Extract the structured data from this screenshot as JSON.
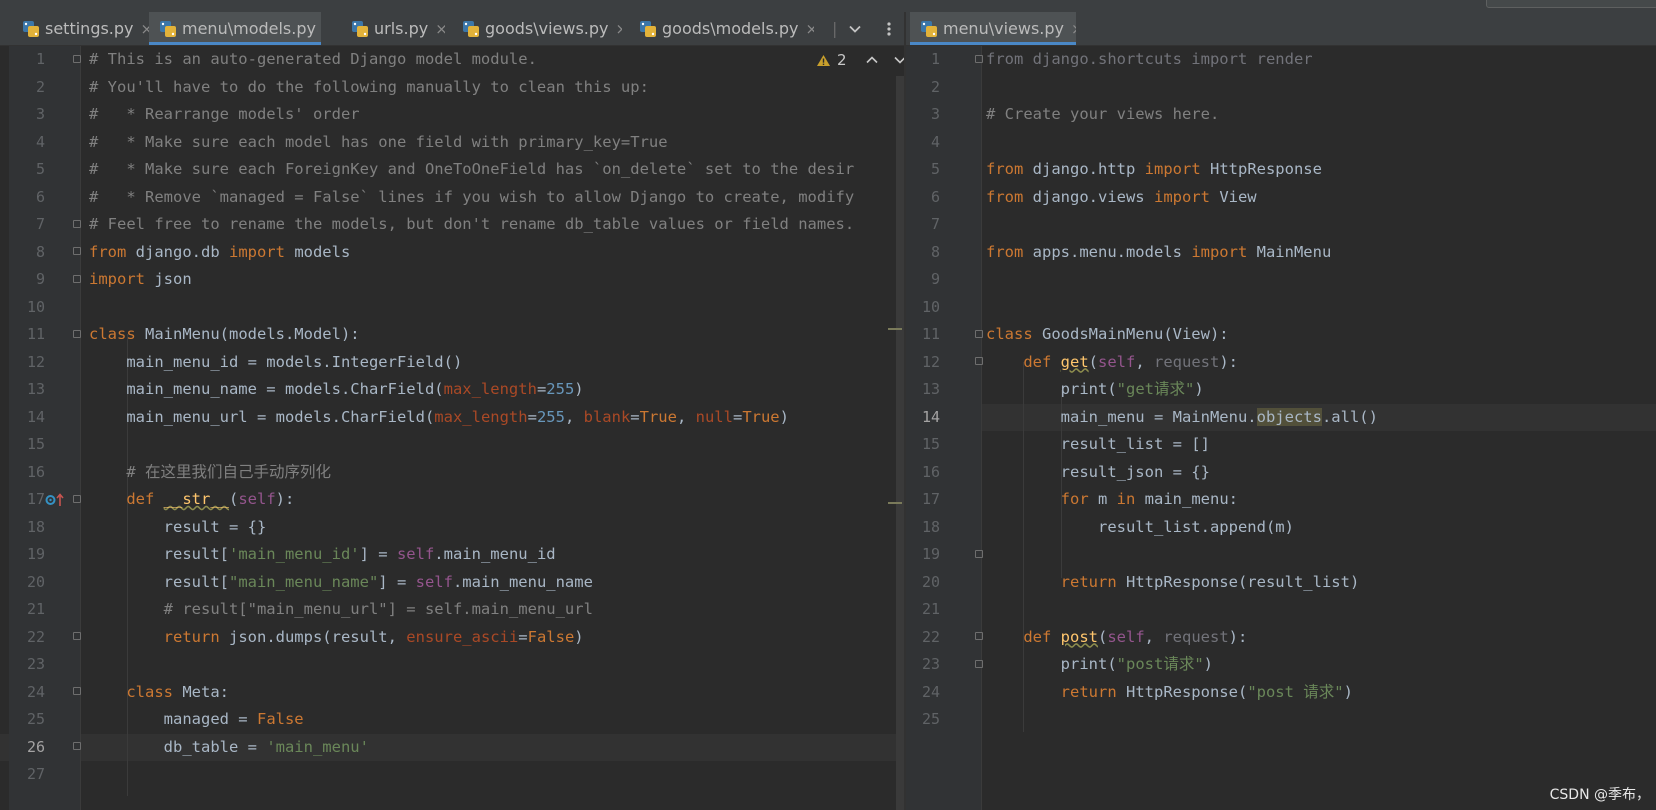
{
  "tabs_left": [
    {
      "label": "settings.py",
      "active": false
    },
    {
      "label": "menu\\models.py",
      "active": true
    },
    {
      "label": "urls.py",
      "active": false
    },
    {
      "label": "goods\\views.py",
      "active": false
    },
    {
      "label": "goods\\models.py",
      "active": false
    }
  ],
  "tabs_right": [
    {
      "label": "menu\\views.py",
      "active": true
    }
  ],
  "tab_close_glyph": "×",
  "tab_overflow_glyph": "|",
  "warnings": {
    "count": "2"
  },
  "left_editor": {
    "caret_line": 26,
    "lines": [
      "# This is an auto-generated Django model module.",
      "# You'll have to do the following manually to clean this up:",
      "#   * Rearrange models' order",
      "#   * Make sure each model has one field with primary_key=True",
      "#   * Make sure each ForeignKey and OneToOneField has `on_delete` set to the desir",
      "#   * Remove `managed = False` lines if you wish to allow Django to create, modify",
      "# Feel free to rename the models, but don't rename db_table values or field names.",
      "from django.db import models",
      "import json",
      "",
      "class MainMenu(models.Model):",
      "    main_menu_id = models.IntegerField()",
      "    main_menu_name = models.CharField(max_length=255)",
      "    main_menu_url = models.CharField(max_length=255, blank=True, null=True)",
      "",
      "    # 在这里我们自己手动序列化",
      "    def __str__(self):",
      "        result = {}",
      "        result['main_menu_id'] = self.main_menu_id",
      "        result[\"main_menu_name\"] = self.main_menu_name",
      "        # result[\"main_menu_url\"] = self.main_menu_url",
      "        return json.dumps(result, ensure_ascii=False)",
      "",
      "    class Meta:",
      "        managed = False",
      "        db_table = 'main_menu'",
      ""
    ]
  },
  "right_editor": {
    "caret_line": 14,
    "lines": [
      "from django.shortcuts import render",
      "",
      "# Create your views here.",
      "",
      "from django.http import HttpResponse",
      "from django.views import View",
      "",
      "from apps.menu.models import MainMenu",
      "",
      "",
      "class GoodsMainMenu(View):",
      "    def get(self, request):",
      "        print(\"get请求\")",
      "        main_menu = MainMenu.objects.all()",
      "        result_list = []",
      "        result_json = {}",
      "        for m in main_menu:",
      "            result_list.append(m)",
      "",
      "        return HttpResponse(result_list)",
      "",
      "    def post(self, request):",
      "        print(\"post请求\")",
      "        return HttpResponse(\"post 请求\")",
      ""
    ]
  },
  "watermark": "CSDN @季布，",
  "colors": {
    "background": "#2b2b2b",
    "gutter": "#313335",
    "keyword": "#cc7832",
    "string": "#6a8759",
    "number": "#6897bb",
    "comment": "#808080",
    "self": "#94558d",
    "kwarg": "#aa4926",
    "function": "#ffc66d",
    "active_tab_underline": "#4a88c7"
  }
}
